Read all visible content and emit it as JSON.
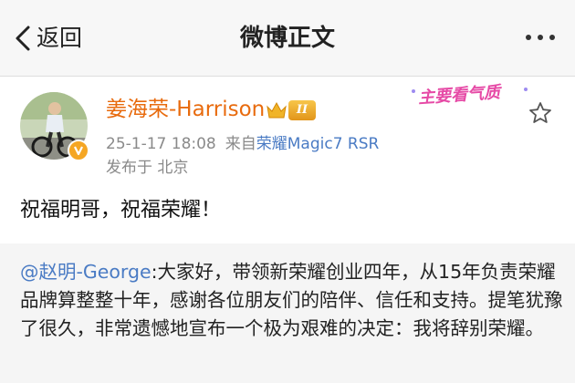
{
  "nav": {
    "back_label": "返回",
    "title": "微博正文"
  },
  "post": {
    "username": "姜海荣-Harrison",
    "member_badge": "II",
    "tag": "主要看气质",
    "time": "25-1-17 18:08",
    "source_prefix": "来自",
    "source": "荣耀Magic7 RSR",
    "location": "发布于 北京",
    "text": "祝福明哥，祝福荣耀！"
  },
  "repost": {
    "mention": "@赵明-George",
    "text": ":大家好，带领新荣耀创业四年，从15年负责荣耀品牌算整整十年，感谢各位朋友们的陪伴、信任和支持。提笔犹豫了很久，非常遗憾地宣布一个极为艰难的决定：我将辞别荣耀。"
  },
  "colors": {
    "username": "#e86b0e",
    "link": "#4a7bc4",
    "meta": "#8a8a8a",
    "tag": "#e64aa6"
  },
  "icons": {
    "back": "chevron-left-icon",
    "more": "more-dots-icon",
    "favorite": "star-outline-icon",
    "verified": "verified-badge-icon",
    "crown": "crown-icon"
  }
}
